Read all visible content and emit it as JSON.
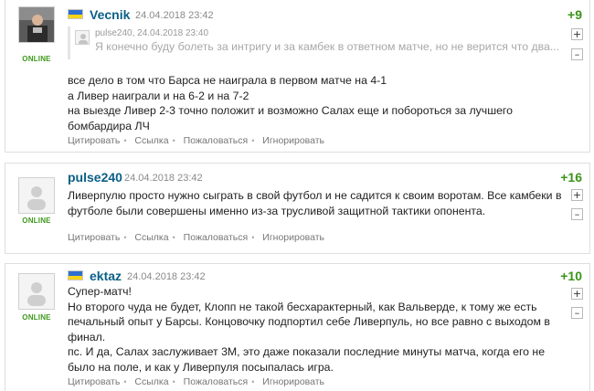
{
  "comments": [
    {
      "username": "Vecnik",
      "date": "24.04.2018 23:42",
      "score": "+9",
      "online": "ONLINE",
      "quote": {
        "author_date": "pulse240, 24.04.2018 23:40",
        "text": "Я конечно буду болеть за интригу и за камбек в ответном матче, но не верится что два..."
      },
      "lines": [
        "все дело в том что Барса не наиграла в первом матче на 4-1",
        "а Ливер наиграли и на 6-2 и на 7-2",
        "на выезде Ливер 2-3 точно положит и возможно Салах еще и побороться за лучшего",
        "бомбардира ЛЧ"
      ]
    },
    {
      "username": "pulse240",
      "date": "24.04.2018 23:42",
      "score": "+16",
      "online": "ONLINE",
      "lines": [
        "Ливерпулю просто нужно сыграть в свой футбол и не садится к своим воротам. Все камбеки в",
        "футболе были совершены именно из-за трусливой защитной тактики опонента."
      ]
    },
    {
      "username": "ektaz",
      "date": "24.04.2018 23:42",
      "score": "+10",
      "online": "ONLINE",
      "lines": [
        "Супер-матч!",
        "Но второго чуда не будет, Клопп не такой бесхарактерный, как Вальверде, к тому же есть",
        "печальный опыт у Барсы. Концовочку подпортил себе Ливерпуль, но все равно с выходом в",
        "финал.",
        "пс. И да, Салах заслуживает 3М, это даже показали последние минуты матча, когда его не",
        "было на поле, и как у Ливерпуля посыпалась игра."
      ]
    }
  ],
  "actions": {
    "quote": "Цитировать",
    "link": "Ссылка",
    "report": "Пожаловаться",
    "ignore": "Игнорировать",
    "separator": "•"
  },
  "vote": {
    "plus": "+",
    "minus": "–"
  },
  "colors": {
    "username": "#0a6087",
    "score": "#3b9419",
    "online": "#3c9a1a",
    "flag_blue": "#2f6fd0",
    "flag_yellow": "#f7d417"
  }
}
